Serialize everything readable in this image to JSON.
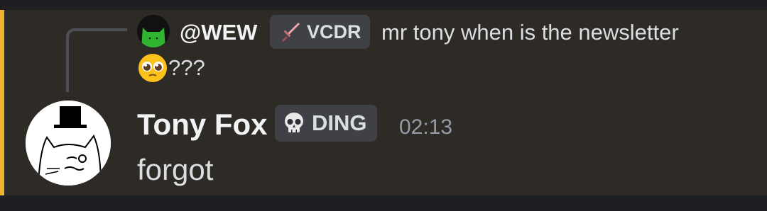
{
  "reply": {
    "username": "@WEW",
    "tag": {
      "label": "VCDR",
      "icon": "sword-icon"
    },
    "text": "mr tony when is the newsletter",
    "trailing_text": "???",
    "emoji": "pleading-face-emoji"
  },
  "message": {
    "author": "Tony Fox",
    "tag": {
      "label": "DING",
      "icon": "skull-icon"
    },
    "timestamp": "02:13",
    "content": "forgot"
  },
  "colors": {
    "mention_highlight_bar": "#f0b232",
    "message_background": "#2e2b27",
    "app_background": "#1e1f22",
    "tag_background": "#3f4147"
  }
}
